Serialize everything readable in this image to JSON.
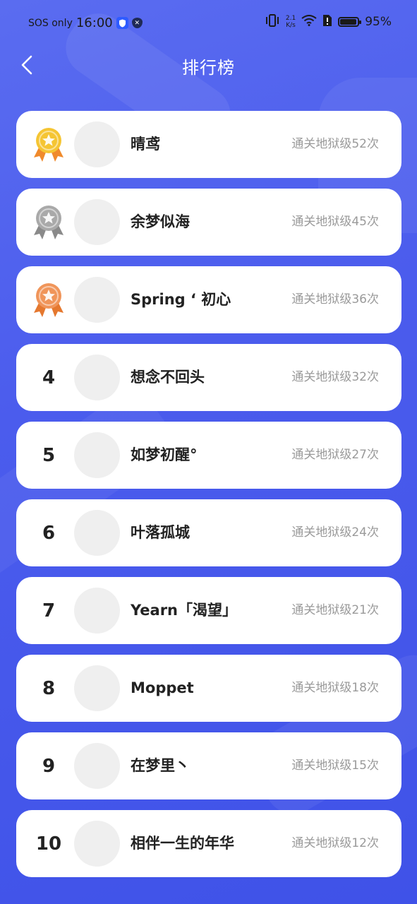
{
  "status_bar": {
    "carrier": "SOS only",
    "time": "16:00",
    "speed_value": "2.1",
    "speed_unit": "K/s",
    "battery_level": 0.95,
    "battery_percent": "95%"
  },
  "header": {
    "title": "排行榜",
    "back_icon": "chevron-left-icon"
  },
  "colors": {
    "background_top": "#5a6cf0",
    "background_bottom": "#3f52e8",
    "gold": "#f5c533",
    "silver": "#a9a9a9",
    "bronze": "#f0955a",
    "score_text": "#9a9a9a"
  },
  "leaderboard": [
    {
      "rank": "1",
      "medal": "gold-medal-icon",
      "name": "晴鸢",
      "score": "通关地狱级52次"
    },
    {
      "rank": "2",
      "medal": "silver-medal-icon",
      "name": "余梦似海",
      "score": "通关地狱级45次"
    },
    {
      "rank": "3",
      "medal": "bronze-medal-icon",
      "name": "Spring ‘ 初心",
      "score": "通关地狱级36次"
    },
    {
      "rank": "4",
      "medal": "",
      "name": "想念不回头",
      "score": "通关地狱级32次"
    },
    {
      "rank": "5",
      "medal": "",
      "name": "如梦初醒°",
      "score": "通关地狱级27次"
    },
    {
      "rank": "6",
      "medal": "",
      "name": "叶落孤城",
      "score": "通关地狱级24次"
    },
    {
      "rank": "7",
      "medal": "",
      "name": "Yearn「渴望」",
      "score": "通关地狱级21次"
    },
    {
      "rank": "8",
      "medal": "",
      "name": "Moppet",
      "score": "通关地狱级18次"
    },
    {
      "rank": "9",
      "medal": "",
      "name": "在梦里丶",
      "score": "通关地狱级15次"
    },
    {
      "rank": "10",
      "medal": "",
      "name": "相伴一生的年华",
      "score": "通关地狱级12次"
    }
  ]
}
